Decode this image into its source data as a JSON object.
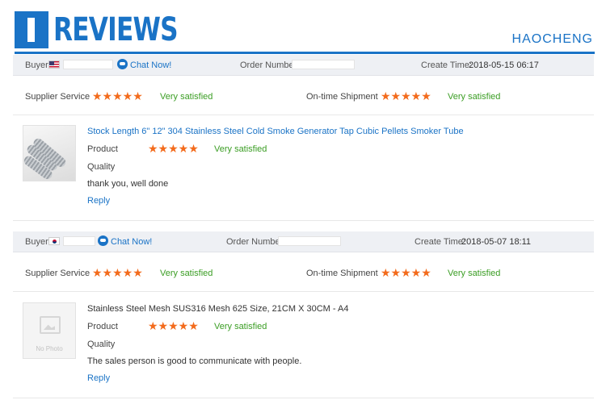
{
  "header": {
    "title": "REVIEWS",
    "brand": "HAOCHENG"
  },
  "colors": {
    "accent": "#1a73c6",
    "star": "#f36b1c",
    "satisfied": "#3a9d23"
  },
  "labels": {
    "buyer": "Buyer:",
    "chat": "Chat Now!",
    "order_number": "Order Number:",
    "create_time": "Create Time:",
    "supplier_service": "Supplier Service",
    "ontime_shipment": "On-time Shipment",
    "product": "Product",
    "quality": "Quality",
    "reply": "Reply",
    "stars": "★★★★★",
    "no_photo": "No Photo"
  },
  "reviews": [
    {
      "buyer_flag": "us-flag-icon",
      "create_time": "2018-05-15 06:17",
      "supplier_service_rating": 5,
      "supplier_service_text": "Very satisfied",
      "shipment_rating": 5,
      "shipment_text": "Very satisfied",
      "product_title": "Stock Length 6\" 12\" 304 Stainless Steel Cold Smoke Generator Tap Cubic Pellets Smoker Tube",
      "product_rating": 5,
      "product_text": "Very satisfied",
      "comment": "thank you, well done"
    },
    {
      "buyer_flag": "kr-flag-icon",
      "create_time": "2018-05-07 18:11",
      "supplier_service_rating": 5,
      "supplier_service_text": "Very satisfied",
      "shipment_rating": 5,
      "shipment_text": "Very satisfied",
      "product_title": "Stainless Steel Mesh SUS316 Mesh 625 Size, 21CM X 30CM - A4",
      "product_rating": 5,
      "product_text": "Very satisfied",
      "comment": "The sales person is good to communicate with people."
    }
  ]
}
